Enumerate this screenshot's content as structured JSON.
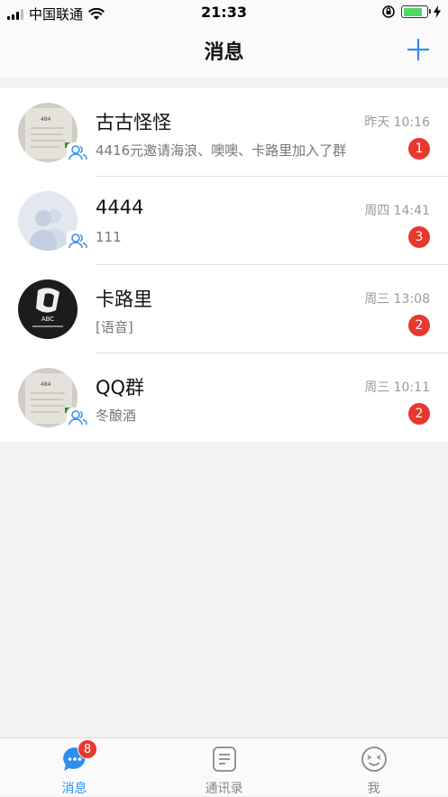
{
  "status_bar": {
    "carrier": "中国联通",
    "time": "21:33"
  },
  "nav": {
    "title": "消息",
    "add_icon": "plus-icon"
  },
  "conversations": [
    {
      "name": "古古怪怪",
      "time": "昨天 10:16",
      "preview": "4416元邀请海浪、噢噢、卡路里加入了群",
      "unread": "1",
      "is_group": true,
      "avatar": "photo"
    },
    {
      "name": "4444",
      "time": "周四 14:41",
      "preview": "111",
      "unread": "3",
      "is_group": true,
      "avatar": "default-group"
    },
    {
      "name": "卡路里",
      "time": "周三 13:08",
      "preview": "[语音]",
      "unread": "2",
      "is_group": false,
      "avatar": "dark-photo",
      "avatar_text": "ABC"
    },
    {
      "name": "QQ群",
      "time": "周三 10:11",
      "preview": "冬酿酒",
      "unread": "2",
      "is_group": true,
      "avatar": "photo"
    }
  ],
  "tab_bar": {
    "tabs": [
      {
        "label": "消息",
        "icon": "chat-bubble-icon",
        "active": true,
        "badge": "8"
      },
      {
        "label": "通讯录",
        "icon": "contacts-icon",
        "active": false
      },
      {
        "label": "我",
        "icon": "face-icon",
        "active": false
      }
    ]
  },
  "colors": {
    "accent": "#2f8ef0",
    "badge": "#e8382f"
  }
}
